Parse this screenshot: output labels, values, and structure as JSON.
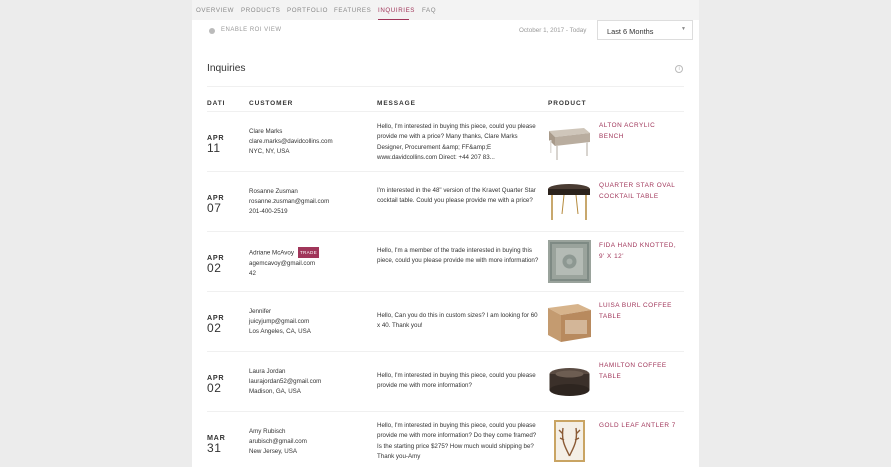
{
  "nav": {
    "tabs": [
      {
        "label": "OVERVIEW"
      },
      {
        "label": "PRODUCTS"
      },
      {
        "label": "PORTFOLIO"
      },
      {
        "label": "FEATURES"
      },
      {
        "label": "INQUIRIES"
      },
      {
        "label": "FAQ"
      }
    ],
    "active_index": 4
  },
  "toolbar": {
    "roi_label": "ENABLE ROI VIEW",
    "date_range": "October 1, 2017 - Today",
    "period_select": "Last 6 Months"
  },
  "section": {
    "title": "Inquiries"
  },
  "table": {
    "headers": {
      "date": "DATE",
      "customer": "CUSTOMER",
      "message": "MESSAGE",
      "product": "PRODUCT"
    },
    "rows": [
      {
        "month": "APR",
        "day": "11",
        "customer": {
          "name": "Clare Marks",
          "badge": "",
          "email": "clare.marks@davidcollins.com",
          "location": "NYC, NY, USA"
        },
        "message": "Hello, I'm interested in buying this piece, could you please provide me with a price? Many thanks, Clare Marks Designer, Procurement &amp; FF&amp;E www.davidcollins.com Direct: +44 207 83...",
        "product": "ALTON ACRYLIC BENCH",
        "thumb_icon": "bench-thumbnail"
      },
      {
        "month": "APR",
        "day": "07",
        "customer": {
          "name": "Rosanne Zusman",
          "badge": "",
          "email": "rosanne.zusman@gmail.com",
          "location": "201-400-2519"
        },
        "message": "I'm interested in the 48\" version of the Kravet Quarter Star cocktail table. Could you please provide me with a price?",
        "product": "QUARTER STAR OVAL COCKTAIL TABLE",
        "thumb_icon": "cocktail-table-thumbnail"
      },
      {
        "month": "APR",
        "day": "02",
        "customer": {
          "name": "Adriane McAvoy",
          "badge": "TRADE",
          "email": "agemcavoy@gmail.com",
          "location": "42"
        },
        "message": "Hello, I'm a member of the trade interested in buying this piece, could you please provide me with more information?",
        "product": "FIDA HAND KNOTTED, 9' X 12'",
        "thumb_icon": "rug-thumbnail"
      },
      {
        "month": "APR",
        "day": "02",
        "customer": {
          "name": "Jennifer",
          "badge": "",
          "email": "juicyjump@gmail.com",
          "location": "Los Angeles, CA, USA"
        },
        "message": "Hello, Can you do this in custom sizes? I am looking for 60 x 40.  Thank you!",
        "product": "LUISA BURL COFFEE TABLE",
        "thumb_icon": "burl-table-thumbnail"
      },
      {
        "month": "APR",
        "day": "02",
        "customer": {
          "name": "Laura Jordan",
          "badge": "",
          "email": "laurajordan52@gmail.com",
          "location": "Madison, GA, USA"
        },
        "message": "Hello, I'm interested in buying this piece, could you please provide me with more information?",
        "product": "HAMILTON COFFEE TABLE",
        "thumb_icon": "round-table-thumbnail"
      },
      {
        "month": "MAR",
        "day": "31",
        "customer": {
          "name": "Amy Rubisch",
          "badge": "",
          "email": "arubisch@gmail.com",
          "location": "New Jersey, USA"
        },
        "message": "Hello, I'm interested in buying this piece, could you please provide me with more information? Do they come framed? Is the starting price $275? How much would shipping be? Thank you-Amy",
        "product": "GOLD LEAF ANTLER 7",
        "thumb_icon": "antler-print-thumbnail"
      }
    ]
  },
  "colors": {
    "accent": "#a0365a",
    "text": "#333333",
    "muted": "#999999",
    "background": "#ececec"
  }
}
